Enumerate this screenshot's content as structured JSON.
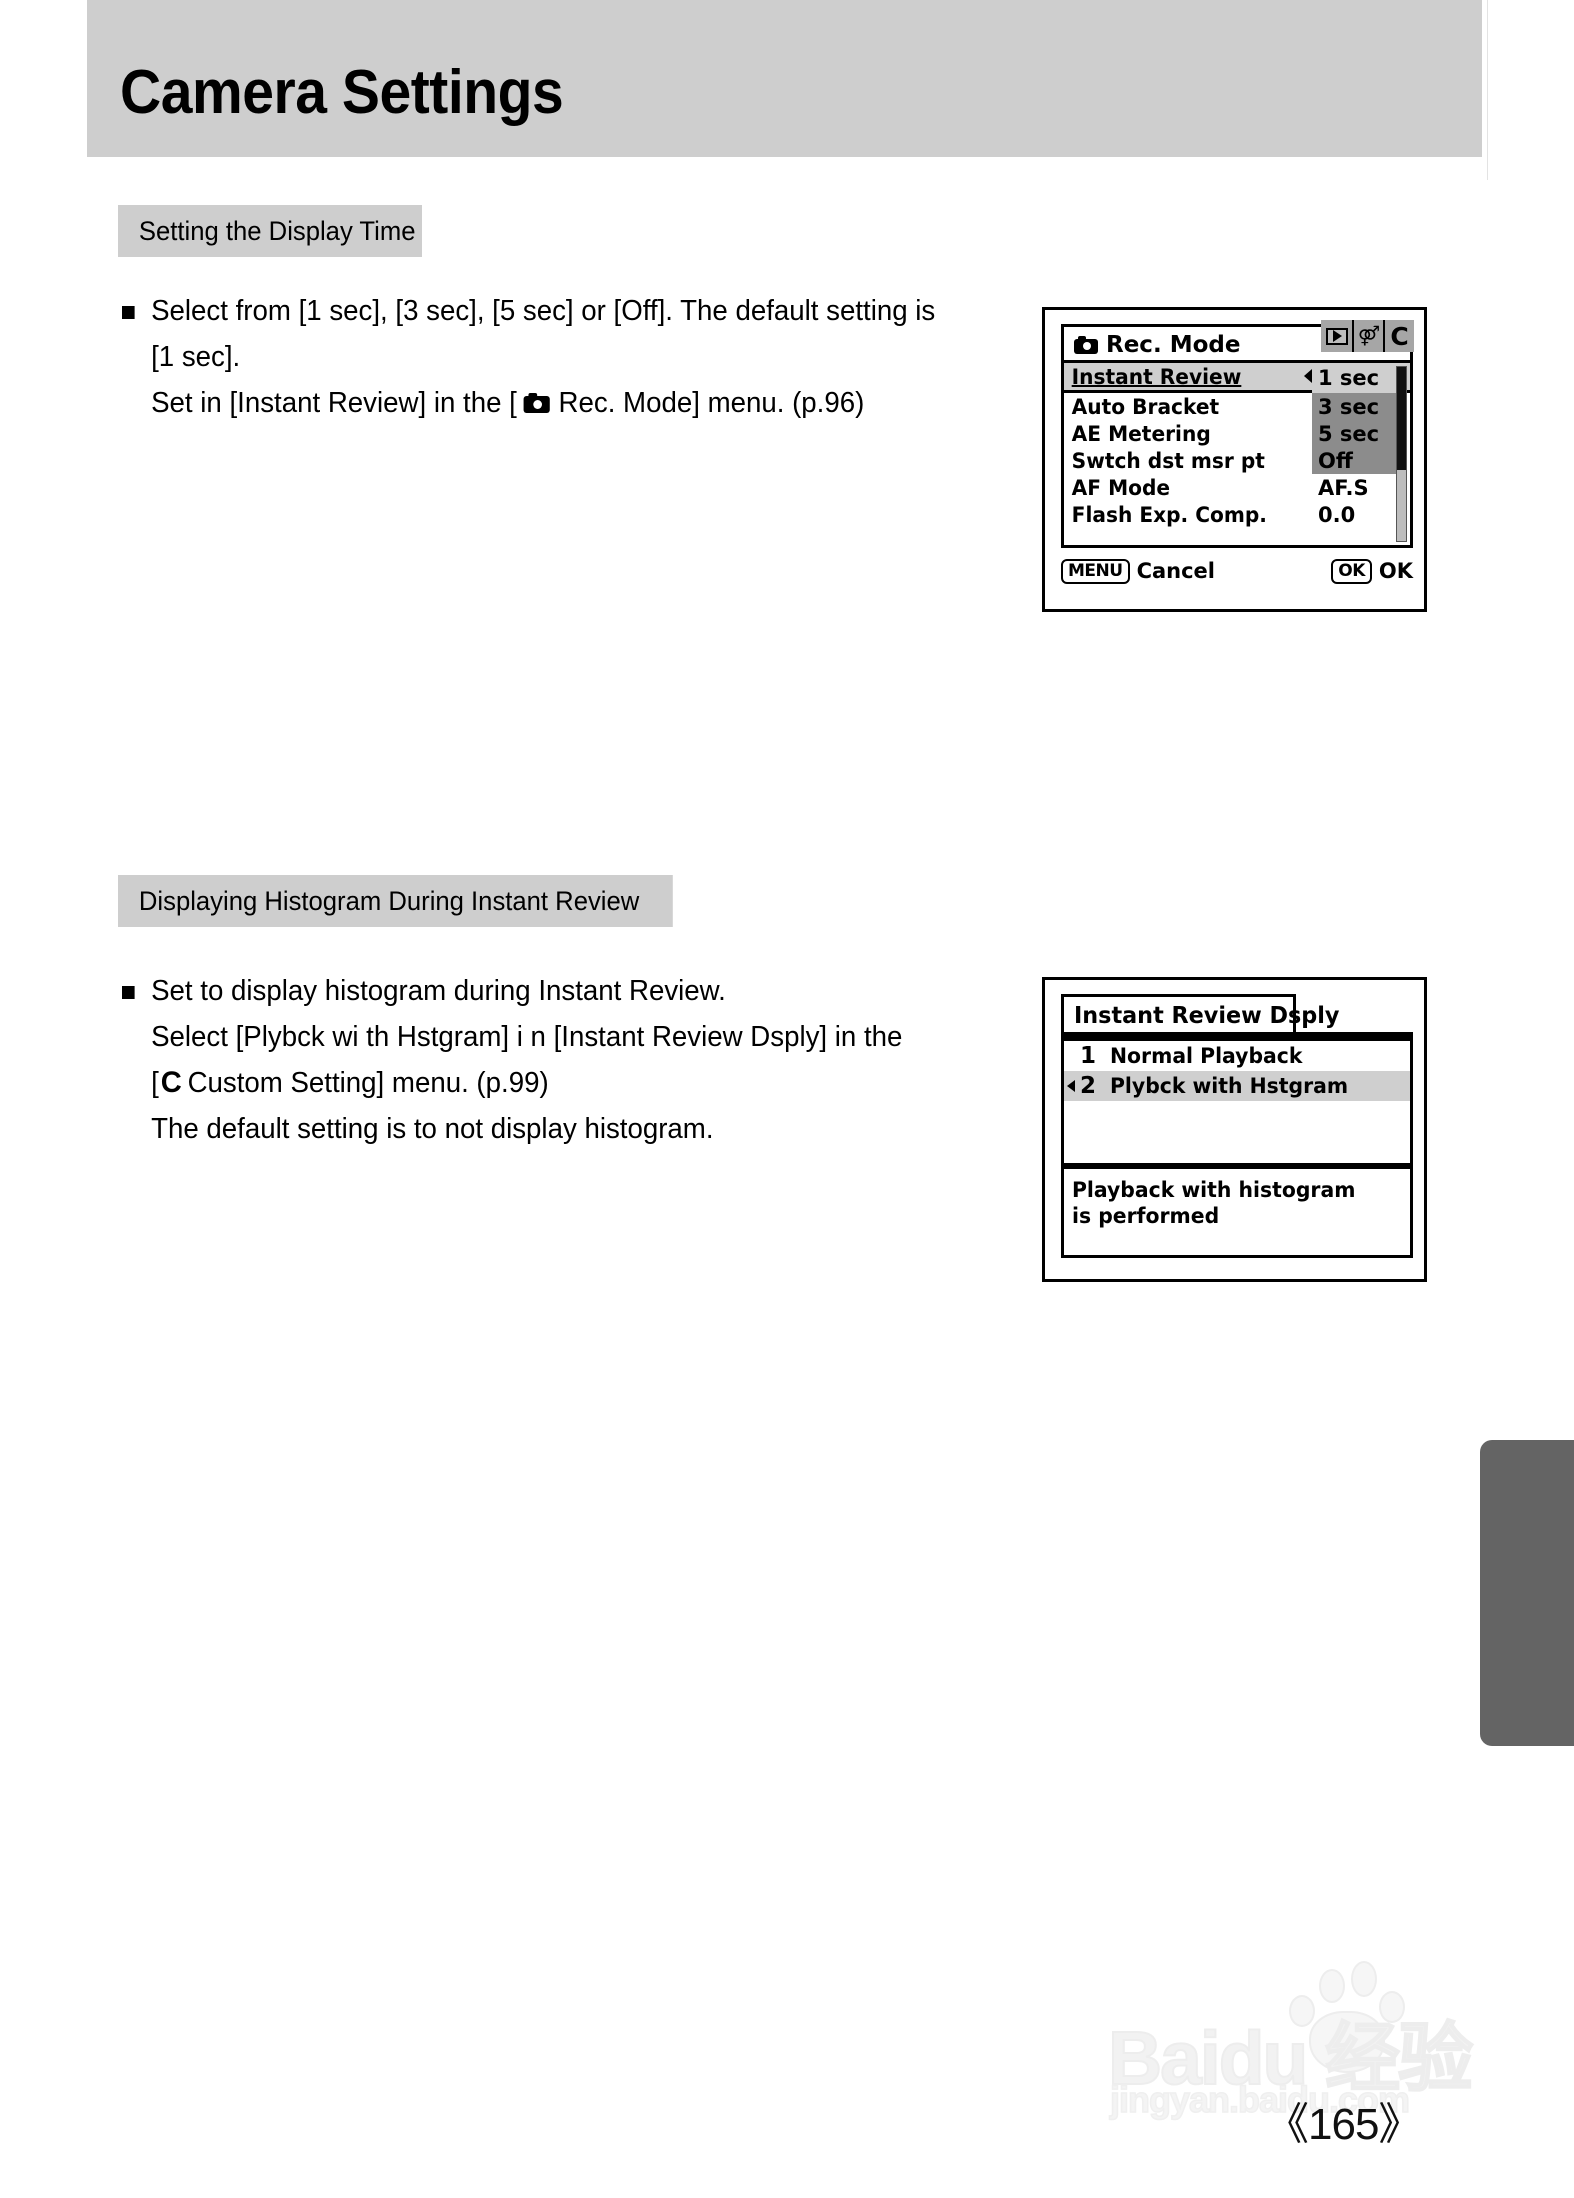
{
  "page": {
    "title": "Camera Settings",
    "number": "《165》"
  },
  "sections": [
    {
      "chip_label": "Setting the Display Time",
      "lines": [
        "Select from [1 sec], [3 sec], [5 sec] or [Off]. The default setting is",
        "[1 sec].",
        "Set in [Instant Review] in the [",
        "Rec. Mode] menu. (p.96)"
      ]
    },
    {
      "chip_label": "Displaying Histogram During Instant Review",
      "lines": [
        "Set to display histogram during Instant Review.",
        "Select [Plybck wi th Hstgram] i n [Instant Review Dsply] in the",
        "[",
        "C",
        "Custom Setting] menu. (p.99)",
        "The default setting is to not display histogram."
      ]
    }
  ],
  "lcd_rec_mode": {
    "title": "Rec. Mode",
    "tabs": [
      "playback-tab",
      "setup-tab",
      "C"
    ],
    "rows": [
      {
        "label": "Instant Review",
        "value": "1 sec",
        "state": "selected"
      },
      {
        "label": "Auto Bracket",
        "value": "3 sec",
        "state": "option"
      },
      {
        "label": "AE Metering",
        "value": "5 sec",
        "state": "option"
      },
      {
        "label": "Swtch dst msr pt",
        "value": "Off",
        "state": "option"
      },
      {
        "label": "AF Mode",
        "value": "AF.S",
        "state": "plain"
      },
      {
        "label": "Flash Exp. Comp.",
        "value": "0.0",
        "state": "plain"
      }
    ],
    "footer": {
      "left_key": "MENU",
      "left_label": "Cancel",
      "right_key": "OK",
      "right_label": "OK"
    }
  },
  "lcd_review_dsply": {
    "title": "Instant Review Dsply",
    "items": [
      {
        "num": "1",
        "label": "Normal Playback",
        "selected": false
      },
      {
        "num": "2",
        "label": "Plybck with Hstgram",
        "selected": true
      }
    ],
    "description": "Playback with histogram\nis performed"
  },
  "watermark": {
    "brand": "Baidu 经验",
    "url": "jingyan.baidu.com"
  },
  "colors": {
    "header_band": "#cecece",
    "chip_bg": "#cecece",
    "lcd_highlight": "#cfcfcf",
    "lcd_option_bg": "#8c8c8c",
    "edge_tab": "#646464"
  }
}
